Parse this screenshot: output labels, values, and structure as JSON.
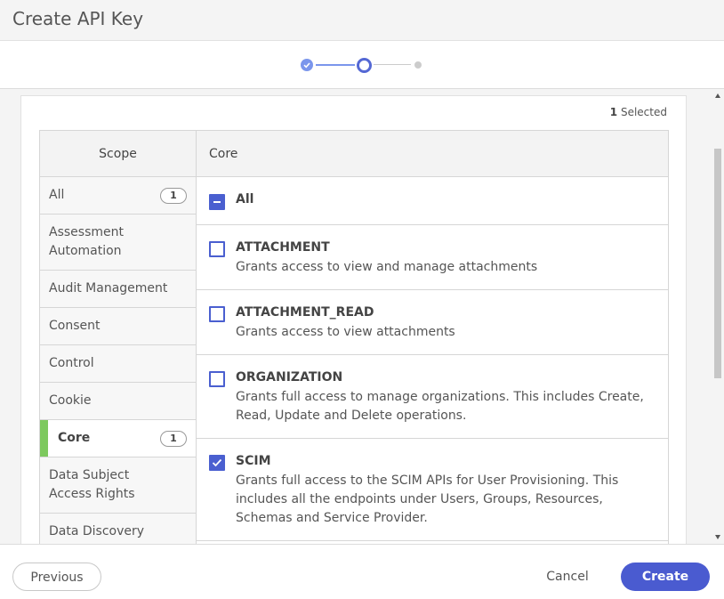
{
  "header": {
    "title": "Create API Key"
  },
  "stepper": {
    "current_step": 2,
    "total_steps": 3
  },
  "selected": {
    "count": "1",
    "label": "Selected"
  },
  "scope": {
    "header": "Scope",
    "items": [
      {
        "label": "All",
        "badge": "1"
      },
      {
        "label": "Assessment Automation"
      },
      {
        "label": "Audit Management"
      },
      {
        "label": "Consent"
      },
      {
        "label": "Control"
      },
      {
        "label": "Cookie"
      },
      {
        "label": "Core",
        "badge": "1",
        "active": true
      },
      {
        "label": "Data Subject Access Rights"
      },
      {
        "label": "Data Discovery"
      }
    ]
  },
  "permissions": {
    "header": "Core",
    "all_label": "All",
    "items": [
      {
        "name": "ATTACHMENT",
        "description": "Grants access to view and manage attachments",
        "checked": false
      },
      {
        "name": "ATTACHMENT_READ",
        "description": "Grants access to view attachments",
        "checked": false
      },
      {
        "name": "ORGANIZATION",
        "description": "Grants full access to manage organizations. This includes Create, Read, Update and Delete operations.",
        "checked": false
      },
      {
        "name": "SCIM",
        "description": "Grants full access to the SCIM APIs for User Provisioning. This includes all the endpoints under Users, Groups, Resources, Schemas and Service Provider.",
        "checked": true
      }
    ]
  },
  "footer": {
    "previous": "Previous",
    "cancel": "Cancel",
    "create": "Create"
  },
  "colors": {
    "primary": "#4a5bd0",
    "active_marker": "#7dc95e",
    "step_done": "#7b96ec"
  }
}
